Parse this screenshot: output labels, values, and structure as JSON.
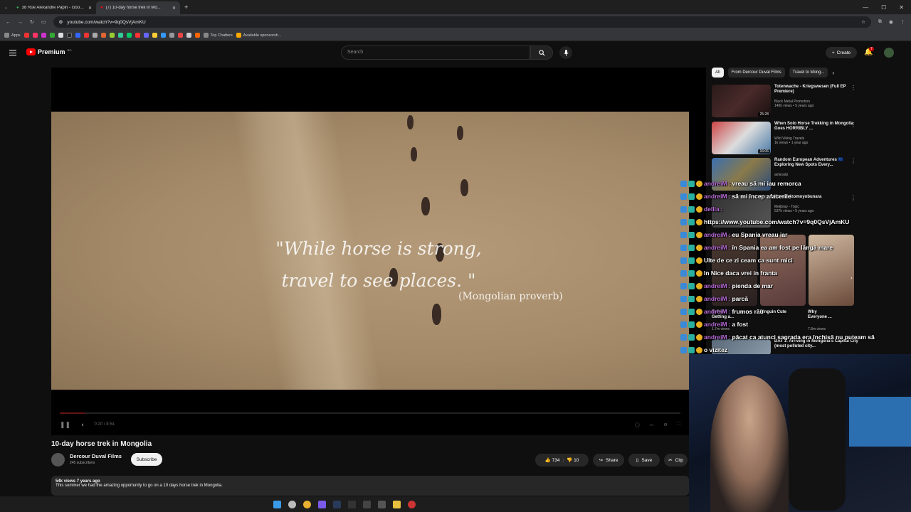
{
  "browser": {
    "tabs": [
      {
        "label": "38 Rue Alexandre Papin - Goog..."
      },
      {
        "label": "(7) 10-day horse trek in Mo..."
      }
    ],
    "url": "youtube.com/watch?v=9q0QsVjAmKU",
    "bookmarks": {
      "apps": "Apps",
      "top_chatters": "Top Chatters",
      "sponsorships": "Available sponsorsh..."
    }
  },
  "header": {
    "logo": "Premium",
    "logo_region": "RO",
    "search_placeholder": "Search",
    "create_label": "Create",
    "notification_count": "7"
  },
  "player": {
    "quote_line1": "\"While horse is strong,",
    "quote_line2": "travel to see places. \"",
    "quote_source": "(Mongolian proverb)",
    "time": "0:20 / 8:54",
    "progress": 0.04
  },
  "video": {
    "title": "10-day horse trek in Mongolia",
    "channel": "Dercour Duval Films",
    "subscribers": "245 subscribers",
    "subscribe_label": "Subscribe",
    "likes": "734",
    "dislikes": "10",
    "share_label": "Share",
    "save_label": "Save",
    "clip_label": "Clip",
    "meta": "54k views  7 years ago",
    "description": "This summer we had the amazing opportunity to go on a 10 days horse trek in Mongolia."
  },
  "sidebar": {
    "chips": [
      {
        "label": "All"
      },
      {
        "label": "From Dercour Duval Films"
      },
      {
        "label": "Travel to Mong..."
      }
    ],
    "recs": [
      {
        "title": "Totenwache - Kriegswesen (Full EP Premiere)",
        "channel": "Black Metal Promotion",
        "meta": "140k views • 5 years ago",
        "duration": "25:28"
      },
      {
        "title": "When Solo Horse Trekking in Mongolia Goes HORRIBLY ...",
        "channel": "Wild Viking Travels",
        "meta": "1k views • 1 year ago",
        "duration": "16:06"
      },
      {
        "title": "Random European Adventures 🇪🇺 Exploring New Spots Every...",
        "channel": "amiroobi",
        "meta": "",
        "duration": ""
      },
      {
        "title": "Korewoizomoyobunara",
        "channel": "Meljbray - Topic",
        "meta": "537k views • 5 years ago",
        "duration": ""
      }
    ],
    "shorts": [
      {
        "title": "Before Getting a...",
        "meta": "1.7m views"
      },
      {
        "title": "Pinguin Cute",
        "meta": ""
      },
      {
        "title": "Why Everyone ...",
        "meta": "7.8m views"
      }
    ],
    "last_rec": {
      "title": "DAY 1: Arriving in Mongolia's Capital City (most polluted city..."
    }
  },
  "chat": [
    {
      "user": "andreiM",
      "msg": "vreau să mi iau remorca"
    },
    {
      "user": "andreiM",
      "msg": "să mi încep afacerile"
    },
    {
      "user": "dellia",
      "msg": ""
    },
    {
      "user": "",
      "msg": "https://www.youtube.com/watch?v=9q0QsVjAmKU"
    },
    {
      "user": "andreiM",
      "msg": "eu Spania vreau iar"
    },
    {
      "user": "andreiM",
      "msg": "în Spania ea am fost pe lângă mare"
    },
    {
      "user": "",
      "msg": "Ulte de ce zi ceam ca sunt mici"
    },
    {
      "user": "",
      "msg": "In Nice daca vrei in franta"
    },
    {
      "user": "andreiM",
      "msg": "pienda de mar"
    },
    {
      "user": "andreiM",
      "msg": "parcă"
    },
    {
      "user": "andreiM",
      "msg": "frumos rău"
    },
    {
      "user": "andreiM",
      "msg": "a fost"
    },
    {
      "user": "andreiM",
      "msg": "păcat ca atunci sagrada era închisă nu puteam să"
    },
    {
      "user": "",
      "msg": "o vizitez"
    }
  ],
  "colors": {
    "accent": "#ff0000",
    "chat_user": "#b86bd9",
    "background": "#0f0f0f"
  }
}
